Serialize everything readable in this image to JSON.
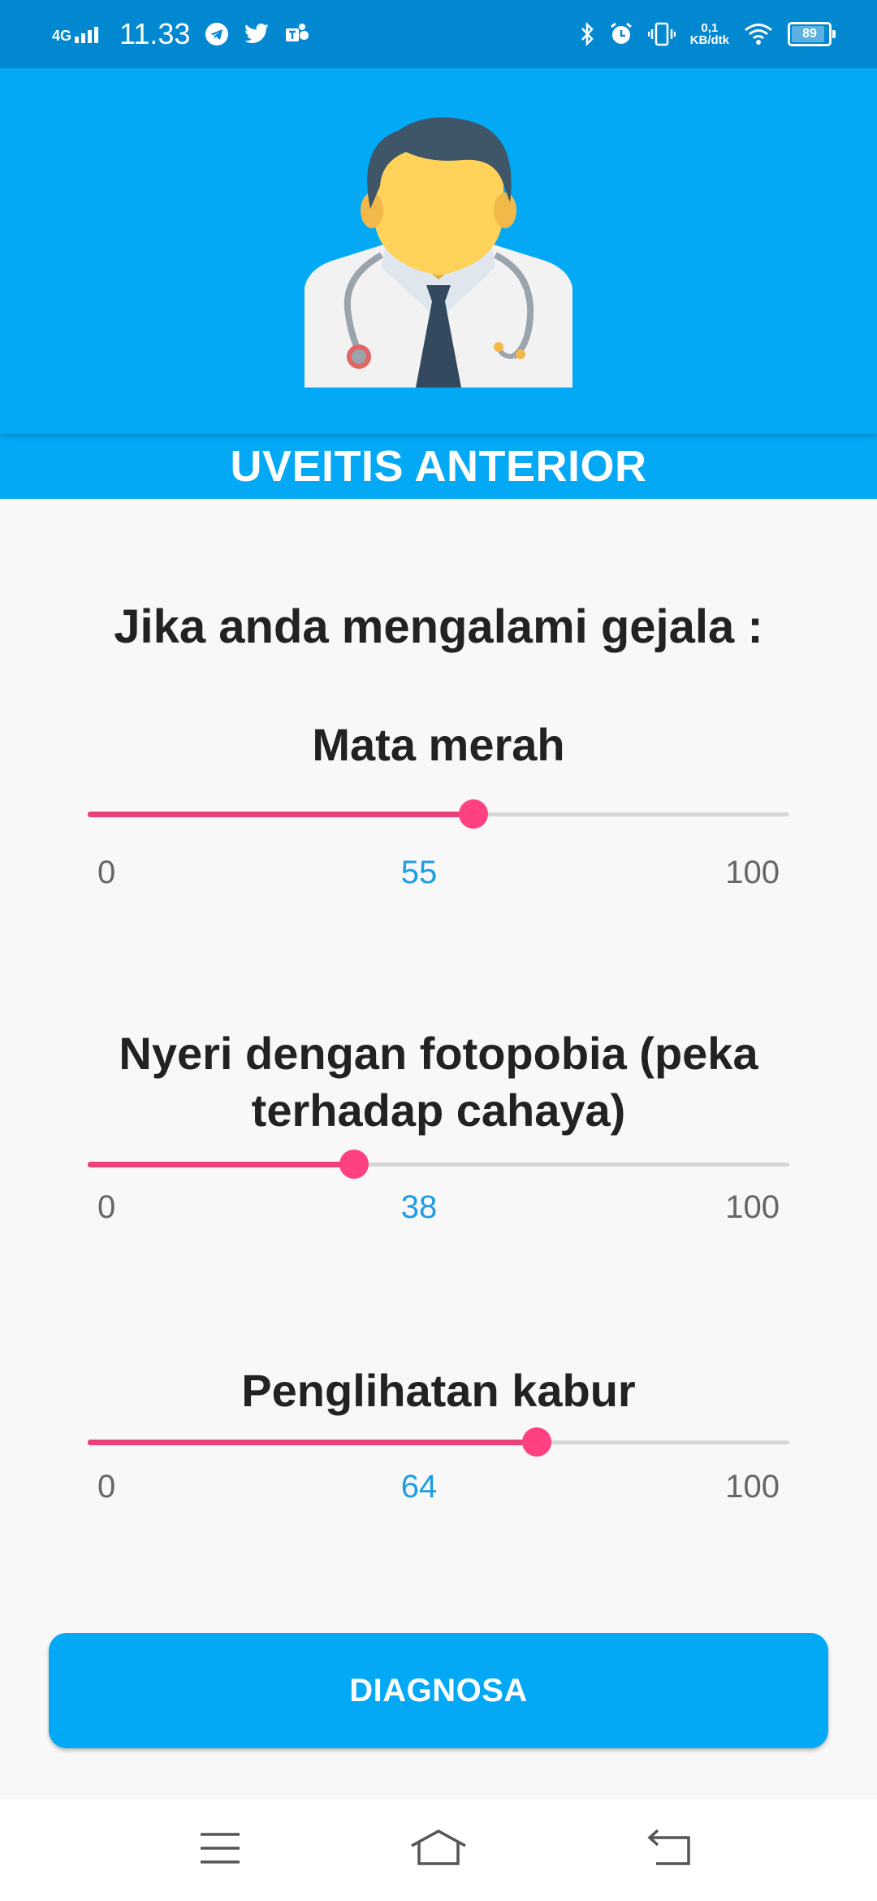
{
  "status_bar": {
    "network": "4G",
    "time": "11.33",
    "speed_value": "0,1",
    "speed_unit": "KB/dtk",
    "battery": "89",
    "left_icons": [
      "telegram-icon",
      "twitter-icon",
      "teams-icon"
    ],
    "right_icons": [
      "bluetooth-icon",
      "alarm-icon",
      "vibrate-icon",
      "wifi-icon",
      "battery-icon"
    ]
  },
  "header": {
    "avatar_icon": "doctor-avatar-icon",
    "title": "UVEITIS ANTERIOR"
  },
  "main": {
    "prompt": "Jika anda mengalami gejala :",
    "symptoms": [
      {
        "label": "Mata merah",
        "min": "0",
        "value": 55,
        "value_text": "55",
        "max": "100"
      },
      {
        "label": "Nyeri dengan fotopobia (peka terhadap cahaya)",
        "min": "0",
        "value": 38,
        "value_text": "38",
        "max": "100"
      },
      {
        "label": "Penglihatan kabur",
        "min": "0",
        "value": 64,
        "value_text": "64",
        "max": "100"
      }
    ],
    "button_label": "DIAGNOSA"
  },
  "nav_bar": {
    "icons": [
      "menu-icon",
      "home-icon",
      "back-icon"
    ]
  },
  "colors": {
    "status_bar": "#0288d1",
    "primary": "#03a9f4",
    "slider_active": "#ec407a",
    "slider_thumb": "#ff4081",
    "value_text": "#1e9de4"
  }
}
